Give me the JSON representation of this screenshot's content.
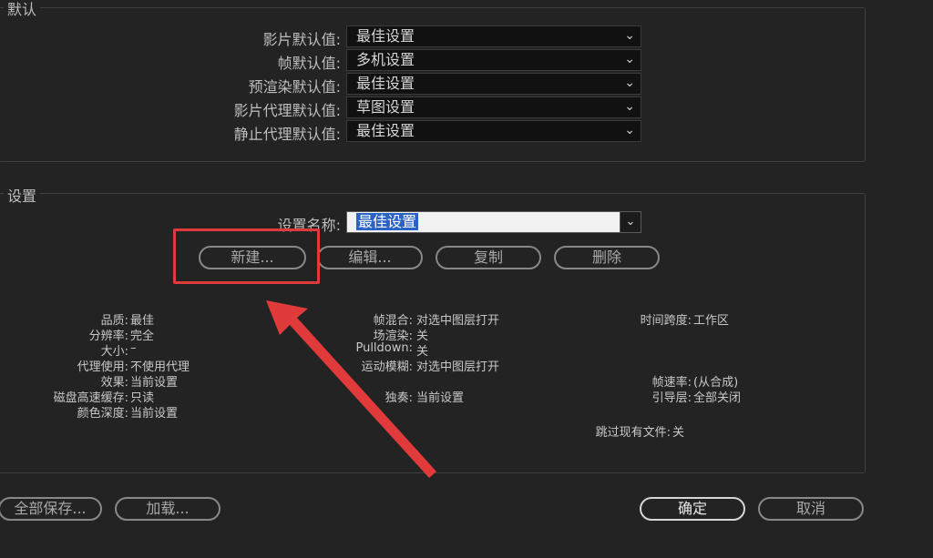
{
  "defaults": {
    "title": "默认",
    "rows": [
      {
        "label": "影片默认值:",
        "value": "最佳设置"
      },
      {
        "label": "帧默认值:",
        "value": "多机设置"
      },
      {
        "label": "预渲染默认值:",
        "value": "最佳设置"
      },
      {
        "label": "影片代理默认值:",
        "value": "草图设置"
      },
      {
        "label": "静止代理默认值:",
        "value": "最佳设置"
      }
    ]
  },
  "settings": {
    "title": "设置",
    "name_label": "设置名称:",
    "name_value": "最佳设置",
    "buttons": {
      "new": "新建...",
      "edit": "编辑...",
      "duplicate": "复制",
      "delete": "删除"
    },
    "info_col1": [
      {
        "label": "品质:",
        "value": "最佳"
      },
      {
        "label": "分辨率:",
        "value": "完全"
      },
      {
        "label": "大小:",
        "value": "–"
      },
      {
        "label": "代理使用:",
        "value": "不使用代理"
      },
      {
        "label": "效果:",
        "value": "当前设置"
      },
      {
        "label": "磁盘高速缓存:",
        "value": "只读"
      },
      {
        "label": "颜色深度:",
        "value": "当前设置"
      }
    ],
    "info_col2": [
      {
        "label": "帧混合:",
        "value": "对选中图层打开"
      },
      {
        "label": "场渲染:",
        "value": "关"
      },
      {
        "label": "Pulldown:",
        "value": "关"
      },
      {
        "label": "运动模糊:",
        "value": "对选中图层打开"
      },
      {
        "label": "独奏:",
        "value": "当前设置"
      }
    ],
    "info_col3": [
      {
        "label": "时间跨度:",
        "value": "工作区"
      },
      {
        "label": "帧速率:",
        "value": "(从合成)"
      },
      {
        "label": "引导层:",
        "value": "全部关闭"
      },
      {
        "label": "跳过现有文件:",
        "value": "关"
      }
    ]
  },
  "footer": {
    "save_all": "全部保存...",
    "load": "加载...",
    "ok": "确定",
    "cancel": "取消"
  },
  "colors": {
    "background": "#232323",
    "annotation": "#e03a3a",
    "selection": "#2a63c7"
  }
}
